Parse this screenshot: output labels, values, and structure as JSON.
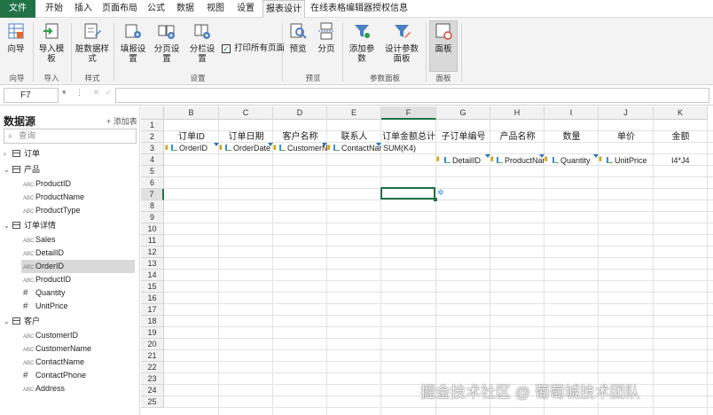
{
  "menu": {
    "tabs": [
      "文件",
      "开始",
      "插入",
      "页面布局",
      "公式",
      "数据",
      "视图",
      "设置",
      "报表设计",
      "在线表格编辑器授权信息"
    ],
    "active": "报表设计"
  },
  "ribbon": {
    "buttons": {
      "wizard": "向导",
      "import_template": "导入模板",
      "dirty_style": "脏数据样式",
      "fill_settings": "填报设置",
      "page_settings": "分页设置",
      "column_settings": "分栏设置",
      "print_all_pages": "打印所有页面",
      "preview": "预览",
      "paging": "分页",
      "add_param": "添加参数",
      "design_param_panel": "设计参数面板",
      "panel": "面板"
    },
    "groups": {
      "wizard": "向导",
      "import": "导入",
      "style": "样式",
      "settings": "设置",
      "preview": "预览",
      "param_panel": "参数面板",
      "panel": "面板"
    },
    "print_all_checked": true
  },
  "formula_bar": {
    "cell_ref": "F7",
    "formula": ""
  },
  "sidebar": {
    "title": "数据源",
    "add_label": "+ 添加表",
    "search_placeholder": "查询",
    "tables": [
      {
        "name": "订单",
        "expanded": false,
        "fields": []
      },
      {
        "name": "产品",
        "expanded": true,
        "fields": [
          {
            "name": "ProductID",
            "type": "ABC"
          },
          {
            "name": "ProductName",
            "type": "ABC"
          },
          {
            "name": "ProductType",
            "type": "ABC"
          }
        ]
      },
      {
        "name": "订单详情",
        "expanded": true,
        "fields": [
          {
            "name": "Sales",
            "type": "ABC"
          },
          {
            "name": "DetailID",
            "type": "ABC"
          },
          {
            "name": "OrderID",
            "type": "ABC",
            "selected": true
          },
          {
            "name": "ProductID",
            "type": "ABC"
          },
          {
            "name": "Quantity",
            "type": "#"
          },
          {
            "name": "UnitPrice",
            "type": "#"
          }
        ]
      },
      {
        "name": "客户",
        "expanded": true,
        "fields": [
          {
            "name": "CustomerID",
            "type": "ABC"
          },
          {
            "name": "CustomerName",
            "type": "ABC"
          },
          {
            "name": "ContactName",
            "type": "ABC"
          },
          {
            "name": "ContactPhone",
            "type": "#"
          },
          {
            "name": "Address",
            "type": "ABC"
          }
        ]
      }
    ]
  },
  "sheet": {
    "columns": [
      "B",
      "C",
      "D",
      "E",
      "F",
      "G",
      "H",
      "I",
      "J",
      "K"
    ],
    "rows": [
      "1",
      "2",
      "3",
      "4",
      "5",
      "6",
      "7",
      "8",
      "9",
      "10",
      "11",
      "12",
      "13",
      "14",
      "15",
      "16",
      "17",
      "18",
      "19",
      "20",
      "21",
      "22",
      "23",
      "24",
      "25"
    ],
    "selected_column": "F",
    "selected_row": "7",
    "headers": [
      "订单ID",
      "订单日期",
      "客户名称",
      "联系人",
      "订单金额总计",
      "子订单编号",
      "产品名称",
      "数量",
      "单价",
      "金额"
    ],
    "row3_fields": [
      "OrderID",
      "OrderDate",
      "CustomerName",
      "ContactName",
      "SUM(K4)"
    ],
    "row4_fields": [
      "DetailID",
      "ProductName",
      "Quantity",
      "UnitPrice",
      "I4*J4"
    ]
  },
  "watermark": "掘金技术社区 @ 葡萄城技术团队"
}
